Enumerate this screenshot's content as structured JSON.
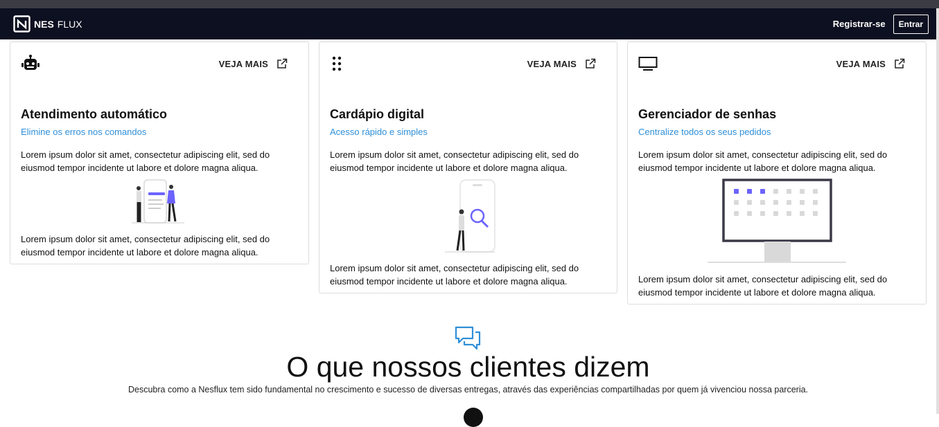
{
  "brand": {
    "name_bold": "NES",
    "name_light": "FLUX"
  },
  "nav": {
    "register": "Registrar-se",
    "login": "Entrar"
  },
  "cards": [
    {
      "icon": "robot-icon",
      "more": "VEJA MAIS",
      "title": "Atendimento automático",
      "subtitle": "Elimine os erros nos comandos",
      "text1": "Lorem ipsum dolor sit amet, consectetur adipiscing elit, sed do eiusmod tempor incidente ut labore et dolore magna aliqua.",
      "text2": "Lorem ipsum dolor sit amet, consectetur adipiscing elit, sed do eiusmod tempor incidente ut labore et dolore magna aliqua."
    },
    {
      "icon": "grip-dots-icon",
      "more": "VEJA MAIS",
      "title": "Cardápio digital",
      "subtitle": "Acesso rápido e simples",
      "text1": "Lorem ipsum dolor sit amet, consectetur adipiscing elit, sed do eiusmod tempor incidente ut labore et dolore magna aliqua.",
      "text2": "Lorem ipsum dolor sit amet, consectetur adipiscing elit, sed do eiusmod tempor incidente ut labore et dolore magna aliqua."
    },
    {
      "icon": "monitor-icon",
      "more": "VEJA MAIS",
      "title": "Gerenciador de senhas",
      "subtitle": "Centralize todos os seus pedidos",
      "text1": "Lorem ipsum dolor sit amet, consectetur adipiscing elit, sed do eiusmod tempor incidente ut labore et dolore magna aliqua.",
      "text2": "Lorem ipsum dolor sit amet, consectetur adipiscing elit, sed do eiusmod tempor incidente ut labore et dolore magna aliqua."
    }
  ],
  "testimonials": {
    "icon": "chat-bubbles-icon",
    "title": "O que nossos clientes dizem",
    "description": "Descubra como a Nesflux tem sido fundamental no crescimento e sucesso de diversas entregas, através das experiências compartilhadas por quem já vivenciou nossa parceria."
  },
  "colors": {
    "navbar": "#0c1020",
    "accent": "#2f8fd8",
    "illustration": "#6c63ff"
  }
}
